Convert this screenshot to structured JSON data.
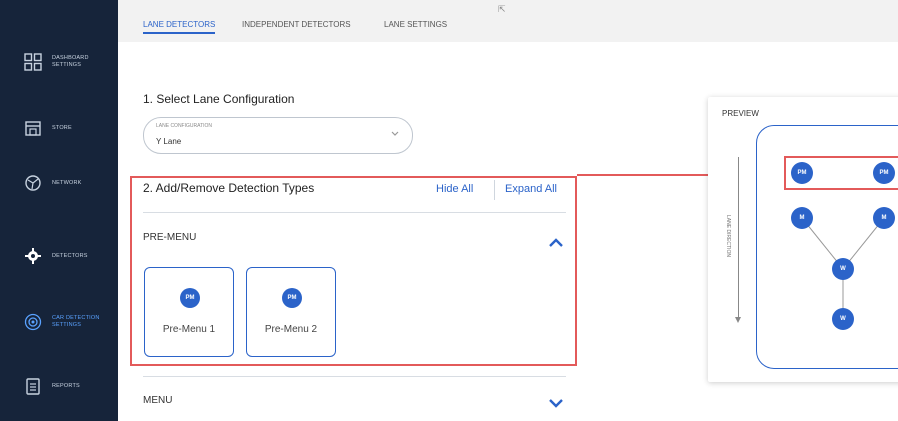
{
  "sidebar": {
    "items": [
      {
        "label": "DASHBOARD SETTINGS",
        "icon": "dashboard-grid-icon",
        "active": false
      },
      {
        "label": "STORE",
        "icon": "store-icon",
        "active": false
      },
      {
        "label": "NETWORK",
        "icon": "network-icon",
        "active": false
      },
      {
        "label": "DETECTORS",
        "icon": "gear-icon",
        "active": false
      },
      {
        "label": "CAR DETECTION SETTINGS",
        "icon": "car-detection-icon",
        "active": true
      },
      {
        "label": "REPORTS",
        "icon": "reports-icon",
        "active": false
      }
    ]
  },
  "tabs": [
    {
      "label": "LANE DETECTORS",
      "active": true
    },
    {
      "label": "INDEPENDENT DETECTORS",
      "active": false
    },
    {
      "label": "LANE SETTINGS",
      "active": false
    }
  ],
  "section1": {
    "title": "1. Select Lane Configuration",
    "select_caption": "LANE CONFIGURATION",
    "select_value": "Y Lane"
  },
  "section2": {
    "title": "2. Add/Remove Detection Types",
    "hide_all": "Hide All",
    "expand_all": "Expand All"
  },
  "groups": {
    "pre_menu": {
      "label": "PRE-MENU",
      "cards": [
        {
          "badge": "PM",
          "label": "Pre-Menu 1"
        },
        {
          "badge": "PM",
          "label": "Pre-Menu 2"
        }
      ]
    },
    "menu": {
      "label": "MENU"
    }
  },
  "preview": {
    "title": "PREVIEW",
    "direction_label": "LANE DIRECTION",
    "nodes": [
      "PM",
      "PM",
      "M",
      "M",
      "W",
      "W"
    ]
  },
  "colors": {
    "sidebar_bg": "#16243a",
    "accent": "#2b63c9",
    "highlight": "#e35a5a"
  }
}
